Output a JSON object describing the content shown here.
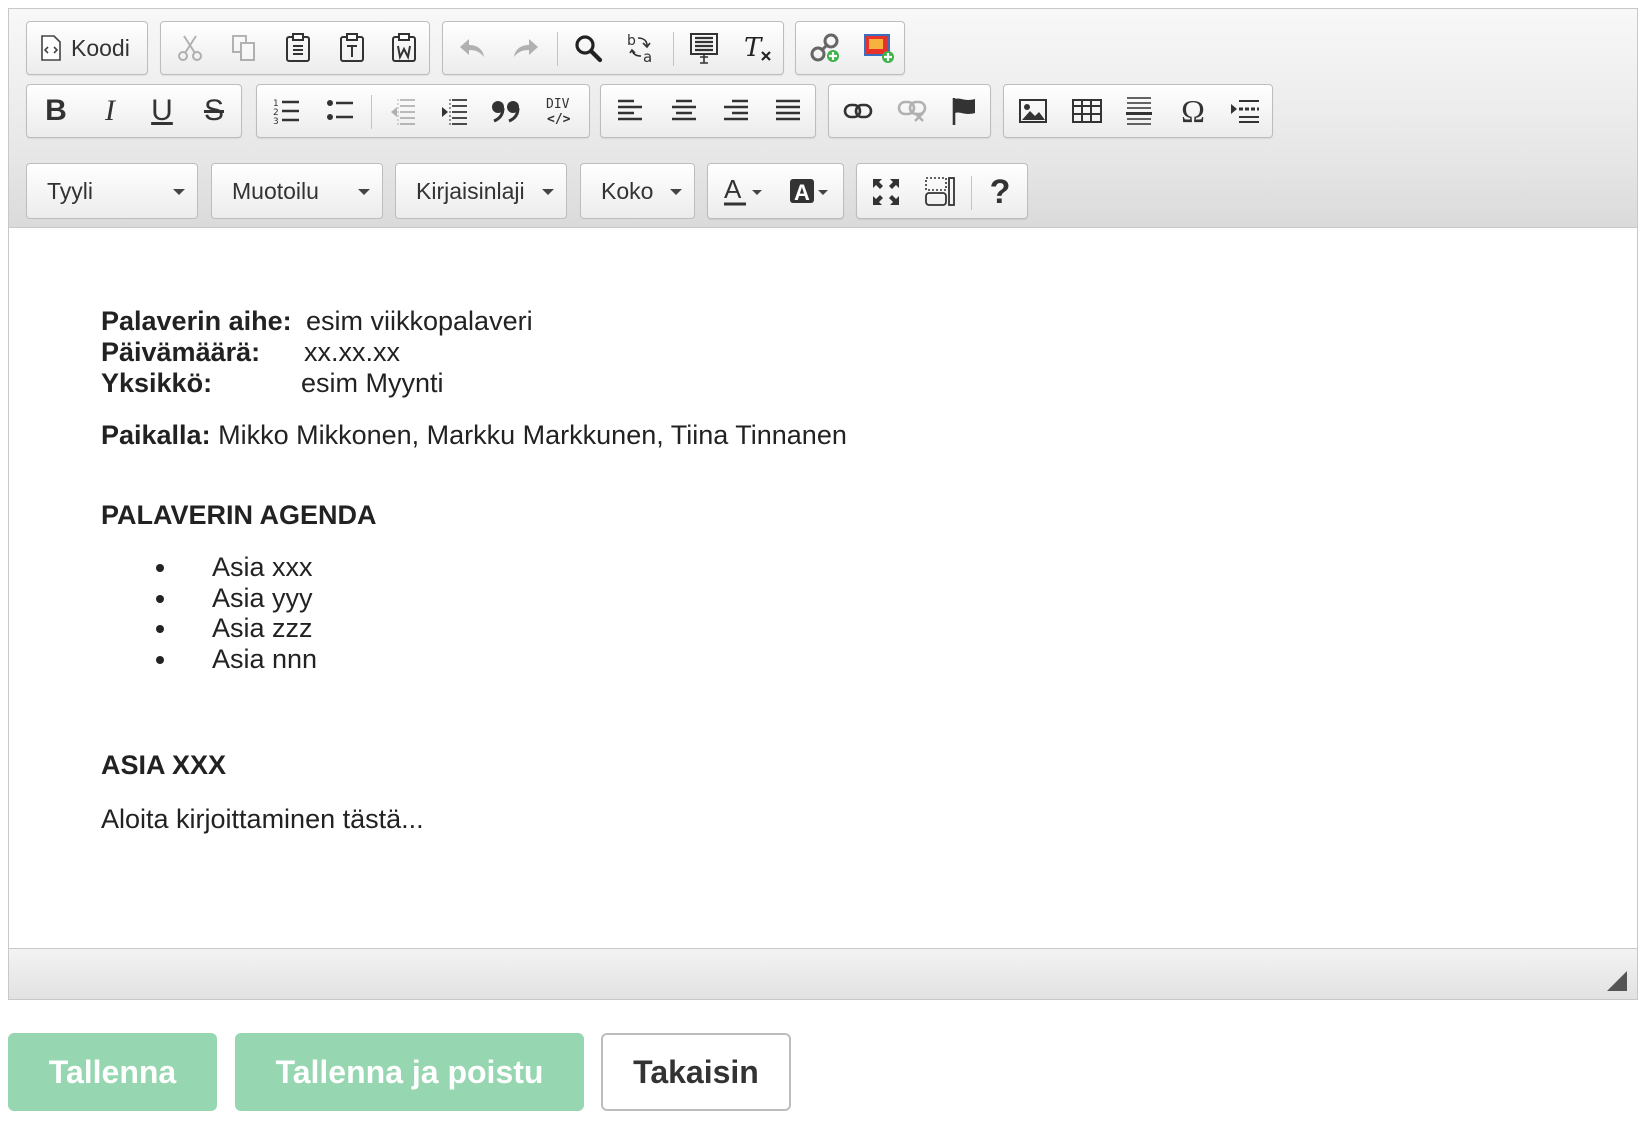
{
  "toolbar": {
    "source_label": "Koodi",
    "styles": {
      "style_label": "Tyyli",
      "format_label": "Muotoilu",
      "font_label": "Kirjaisinlaji",
      "size_label": "Koko"
    }
  },
  "document": {
    "meta": [
      {
        "label": "Palaverin aihe:",
        "value": "esim viikkopalaveri"
      },
      {
        "label": "Päivämäärä:",
        "value": "xx.xx.xx"
      },
      {
        "label": "Yksikkö:",
        "value": "esim Myynti"
      }
    ],
    "present_label": "Paikalla:",
    "present_value": " Mikko Mikkonen, Markku Markkunen, Tiina Tinnanen",
    "agenda_heading": "PALAVERIN AGENDA",
    "agenda_items": [
      "Asia xxx",
      "Asia yyy",
      "Asia zzz",
      "Asia nnn"
    ],
    "section_heading": "ASIA XXX",
    "section_body": "Aloita kirjoittaminen tästä..."
  },
  "actions": {
    "save_label": "Tallenna",
    "save_exit_label": "Tallenna ja poistu",
    "back_label": "Takaisin"
  },
  "colors": {
    "primary_button": "#96d6b0",
    "toolbar_bg": "#e6e6e6"
  }
}
